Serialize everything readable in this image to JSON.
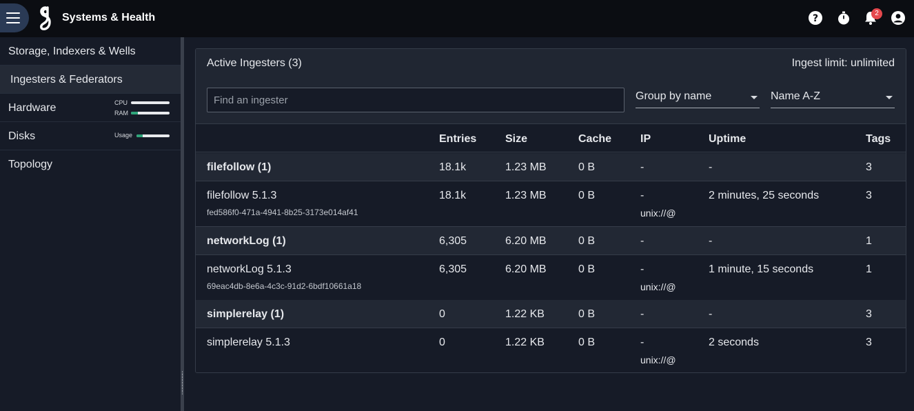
{
  "header": {
    "title": "Systems & Health",
    "notifications_count": "2",
    "icons": [
      "menu-icon",
      "logo-icon",
      "help-icon",
      "stopwatch-icon",
      "bell-icon",
      "account-icon"
    ]
  },
  "sidebar": {
    "items": [
      {
        "label": "Storage, Indexers & Wells",
        "active": false
      },
      {
        "label": "Ingesters & Federators",
        "active": true
      },
      {
        "label": "Hardware",
        "meters": [
          {
            "label": "CPU",
            "fill": 0
          },
          {
            "label": "RAM",
            "fill": 0.18
          }
        ]
      },
      {
        "label": "Disks",
        "meters": [
          {
            "label": "Usage",
            "fill": 0.18
          }
        ]
      },
      {
        "label": "Topology",
        "active": false
      }
    ]
  },
  "card": {
    "title": "Active Ingesters (3)",
    "ingest_limit": "Ingest limit: unlimited",
    "search_placeholder": "Find an ingester",
    "group_select": "Group by name",
    "sort_select": "Name A-Z"
  },
  "table": {
    "columns": [
      "Entries",
      "Size",
      "Cache",
      "IP",
      "Uptime",
      "Tags"
    ],
    "groups": [
      {
        "summary": {
          "name": "filefollow (1)",
          "entries": "18.1k",
          "size": "1.23 MB",
          "cache": "0 B",
          "ip": "-",
          "uptime": "-",
          "tags": "3"
        },
        "item": {
          "name": "filefollow 5.1.3",
          "uuid": "fed586f0-471a-4941-8b25-3173e014af41",
          "entries": "18.1k",
          "size": "1.23 MB",
          "cache": "0 B",
          "ip": "-",
          "ip2": "unix://@",
          "uptime": "2 minutes, 25 seconds",
          "tags": "3"
        }
      },
      {
        "summary": {
          "name": "networkLog (1)",
          "entries": "6,305",
          "size": "6.20 MB",
          "cache": "0 B",
          "ip": "-",
          "uptime": "-",
          "tags": "1"
        },
        "item": {
          "name": "networkLog 5.1.3",
          "uuid": "69eac4db-8e6a-4c3c-91d2-6bdf10661a18",
          "entries": "6,305",
          "size": "6.20 MB",
          "cache": "0 B",
          "ip": "-",
          "ip2": "unix://@",
          "uptime": "1 minute, 15 seconds",
          "tags": "1"
        }
      },
      {
        "summary": {
          "name": "simplerelay (1)",
          "entries": "0",
          "size": "1.22 KB",
          "cache": "0 B",
          "ip": "-",
          "uptime": "-",
          "tags": "3"
        },
        "item": {
          "name": "simplerelay 5.1.3",
          "uuid": "",
          "entries": "0",
          "size": "1.22 KB",
          "cache": "0 B",
          "ip": "-",
          "ip2": "unix://@",
          "uptime": "2 seconds",
          "tags": "3"
        }
      }
    ]
  },
  "colors": {
    "accent": "#2a3a55",
    "meter_fill": "#2ea57a",
    "badge": "#e5484d",
    "background": "#161b27"
  }
}
